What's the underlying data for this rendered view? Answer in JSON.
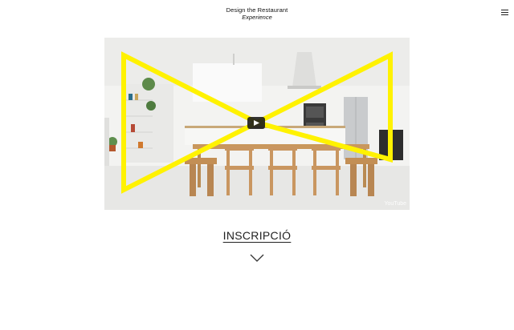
{
  "header": {
    "title_line1": "Design the Restaurant",
    "title_line2": "Experience",
    "menu_icon": "hamburger-icon"
  },
  "video": {
    "play_icon": "play-icon",
    "brand_watermark": "YouTube",
    "overlay_color": "#fff200"
  },
  "cta": {
    "label": "INSCRIPCIÓ",
    "scroll_icon": "chevron-down-icon"
  }
}
